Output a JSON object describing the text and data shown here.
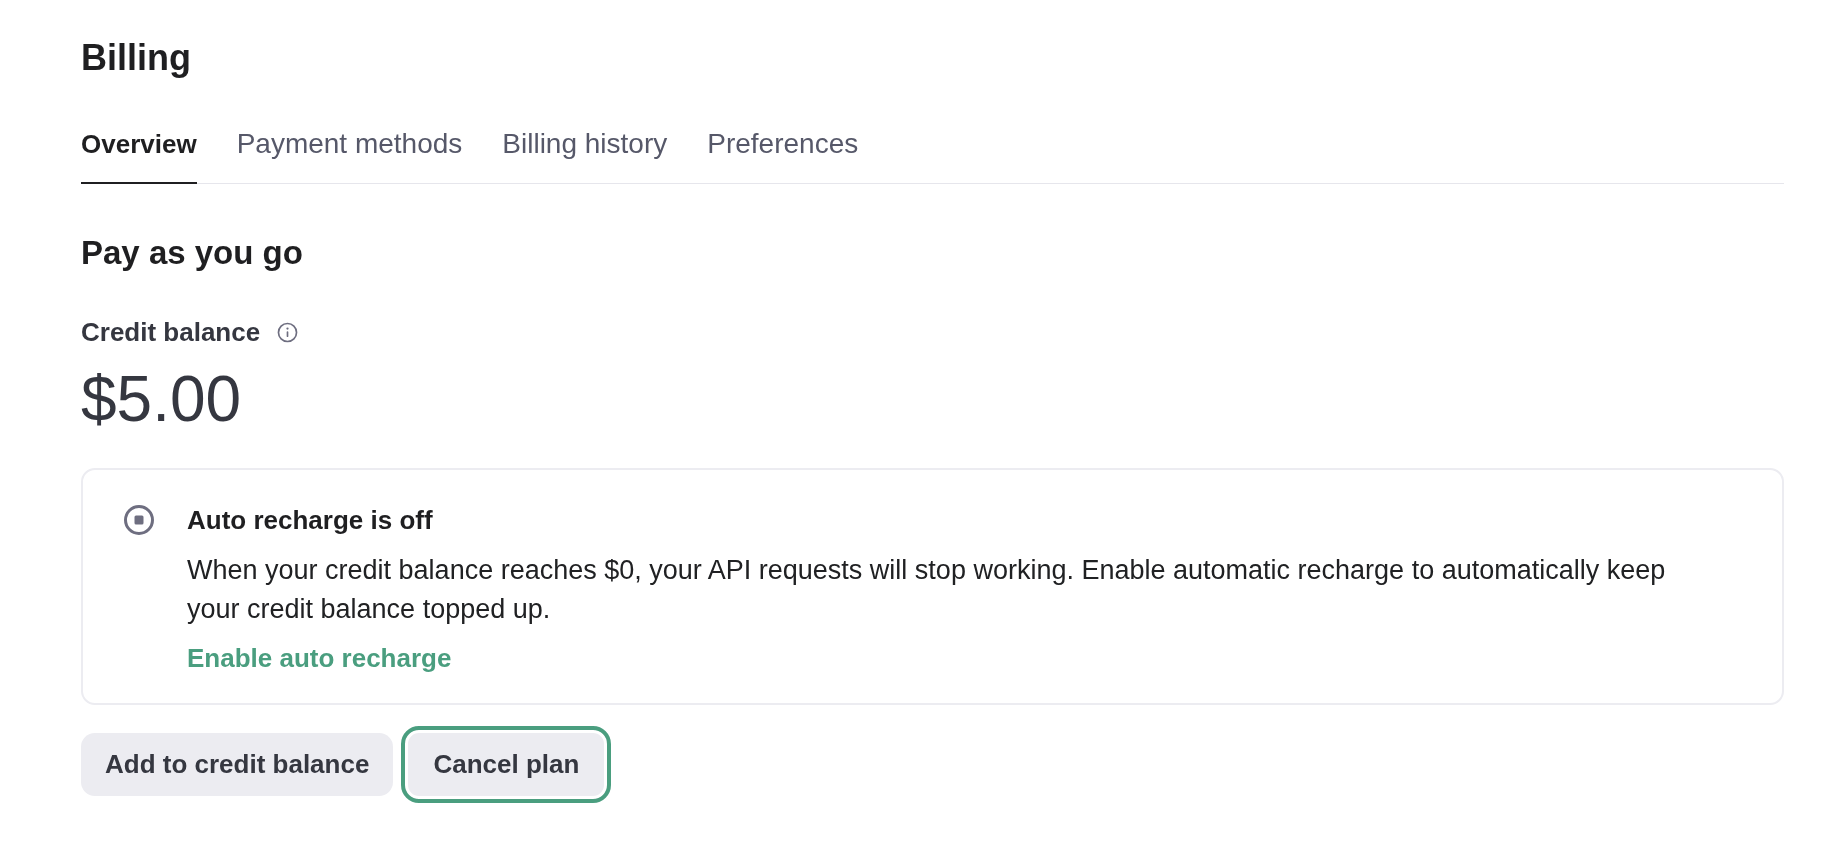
{
  "page": {
    "title": "Billing"
  },
  "tabs": [
    {
      "label": "Overview",
      "selected": true
    },
    {
      "label": "Payment methods",
      "selected": false
    },
    {
      "label": "Billing history",
      "selected": false
    },
    {
      "label": "Preferences",
      "selected": false
    }
  ],
  "section": {
    "title": "Pay as you go"
  },
  "balance": {
    "label": "Credit balance",
    "amount": "$5.00"
  },
  "auto_recharge": {
    "title": "Auto recharge is off",
    "on": false,
    "description": "When your credit balance reaches $0, your API requests will stop working. Enable automatic recharge to automatically keep your credit balance topped up.",
    "link": "Enable auto recharge"
  },
  "buttons": [
    {
      "label": "Add to credit balance",
      "focused": false
    },
    {
      "label": "Cancel plan",
      "focused": true
    }
  ]
}
